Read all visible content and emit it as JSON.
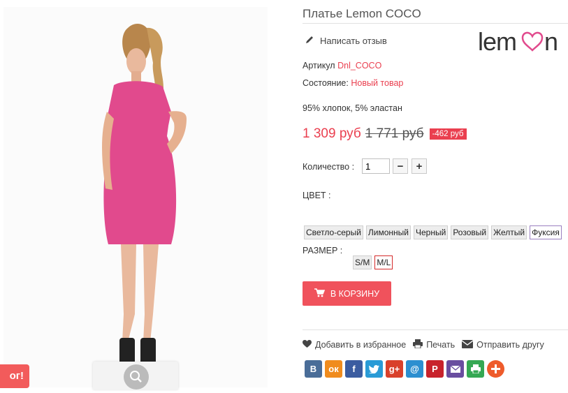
{
  "product": {
    "title": "Платье Lemon COCO",
    "review_link": "Написать отзыв",
    "brand_logo_text": "lemon",
    "sku_label": "Артикул",
    "sku_value": "Dnl_COCO",
    "condition_label": "Состояние:",
    "condition_value": "Новый товар",
    "material": "95% хлопок, 5% эластан"
  },
  "price": {
    "current": "1 309 руб",
    "old": "1 771 руб",
    "discount": "-462 руб"
  },
  "quantity": {
    "label": "Количество :",
    "value": "1",
    "minus": "−",
    "plus": "+"
  },
  "color": {
    "label": "ЦВЕТ :",
    "options": [
      "Светло-серый",
      "Лимонный",
      "Черный",
      "Розовый",
      "Желтый",
      "Фуксия"
    ],
    "selected": "Фуксия"
  },
  "size": {
    "label": "РАЗМЕР :",
    "options": [
      "S/M",
      "M/L"
    ],
    "selected": "M/L"
  },
  "cart": {
    "label": "В КОРЗИНУ"
  },
  "actions": {
    "favorite": "Добавить в избранное",
    "print": "Печать",
    "send": "Отправить другу"
  },
  "share": {
    "vk": "В",
    "ok": "ок",
    "facebook": "f",
    "googleplus": "g+",
    "email_at": "@",
    "pinterest": "P"
  },
  "promo": {
    "text": "ог!"
  },
  "colors": {
    "accent": "#ea3f4f",
    "cart": "#f0525c",
    "dress": "#e14a8d"
  },
  "icons": [
    "pencil-icon",
    "cart-icon",
    "heart-icon",
    "print-icon",
    "envelope-icon",
    "magnify-icon"
  ]
}
